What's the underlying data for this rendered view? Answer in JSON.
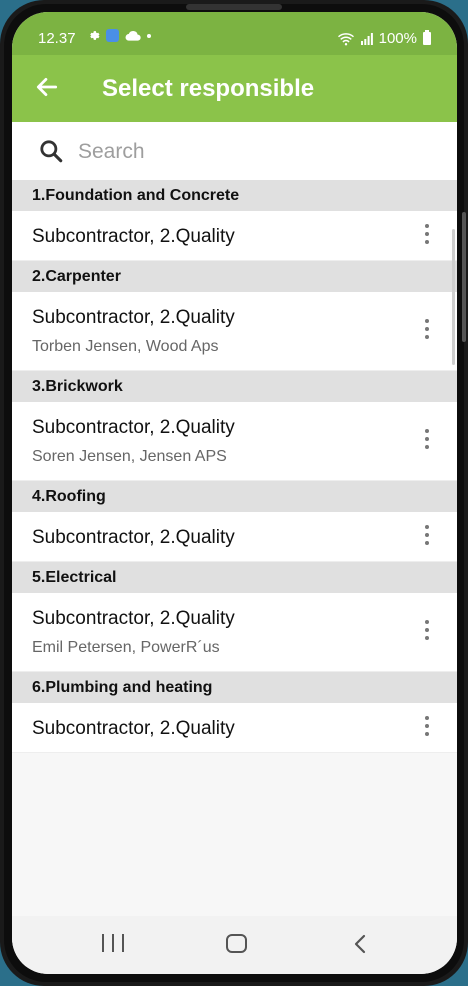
{
  "status_bar": {
    "time": "12.37",
    "battery": "100%",
    "icons": [
      "settings-icon",
      "app-notification-icon",
      "cloud-icon",
      "dot-icon",
      "wifi-icon",
      "signal-icon",
      "battery-icon"
    ]
  },
  "app_bar": {
    "title": "Select responsible",
    "back_icon": "arrow-left-icon",
    "color": "#8bc34a"
  },
  "search": {
    "placeholder": "Search",
    "value": ""
  },
  "sections": [
    {
      "title": "1.Foundation and Concrete",
      "rows": [
        {
          "primary": "Subcontractor, 2.Quality",
          "secondary": ""
        }
      ]
    },
    {
      "title": "2.Carpenter",
      "rows": [
        {
          "primary": "Subcontractor, 2.Quality",
          "secondary": "Torben Jensen, Wood Aps"
        }
      ]
    },
    {
      "title": "3.Brickwork",
      "rows": [
        {
          "primary": "Subcontractor, 2.Quality",
          "secondary": "Soren Jensen, Jensen APS"
        }
      ]
    },
    {
      "title": "4.Roofing",
      "rows": [
        {
          "primary": "Subcontractor, 2.Quality",
          "secondary": ""
        }
      ]
    },
    {
      "title": "5.Electrical",
      "rows": [
        {
          "primary": "Subcontractor, 2.Quality",
          "secondary": "Emil Petersen, PowerR´us"
        }
      ]
    },
    {
      "title": "6.Plumbing and heating",
      "rows": [
        {
          "primary": "Subcontractor, 2.Quality",
          "secondary": ""
        }
      ]
    }
  ],
  "nav_bar": {
    "buttons": [
      "recent-apps-icon",
      "home-icon",
      "back-icon"
    ]
  }
}
